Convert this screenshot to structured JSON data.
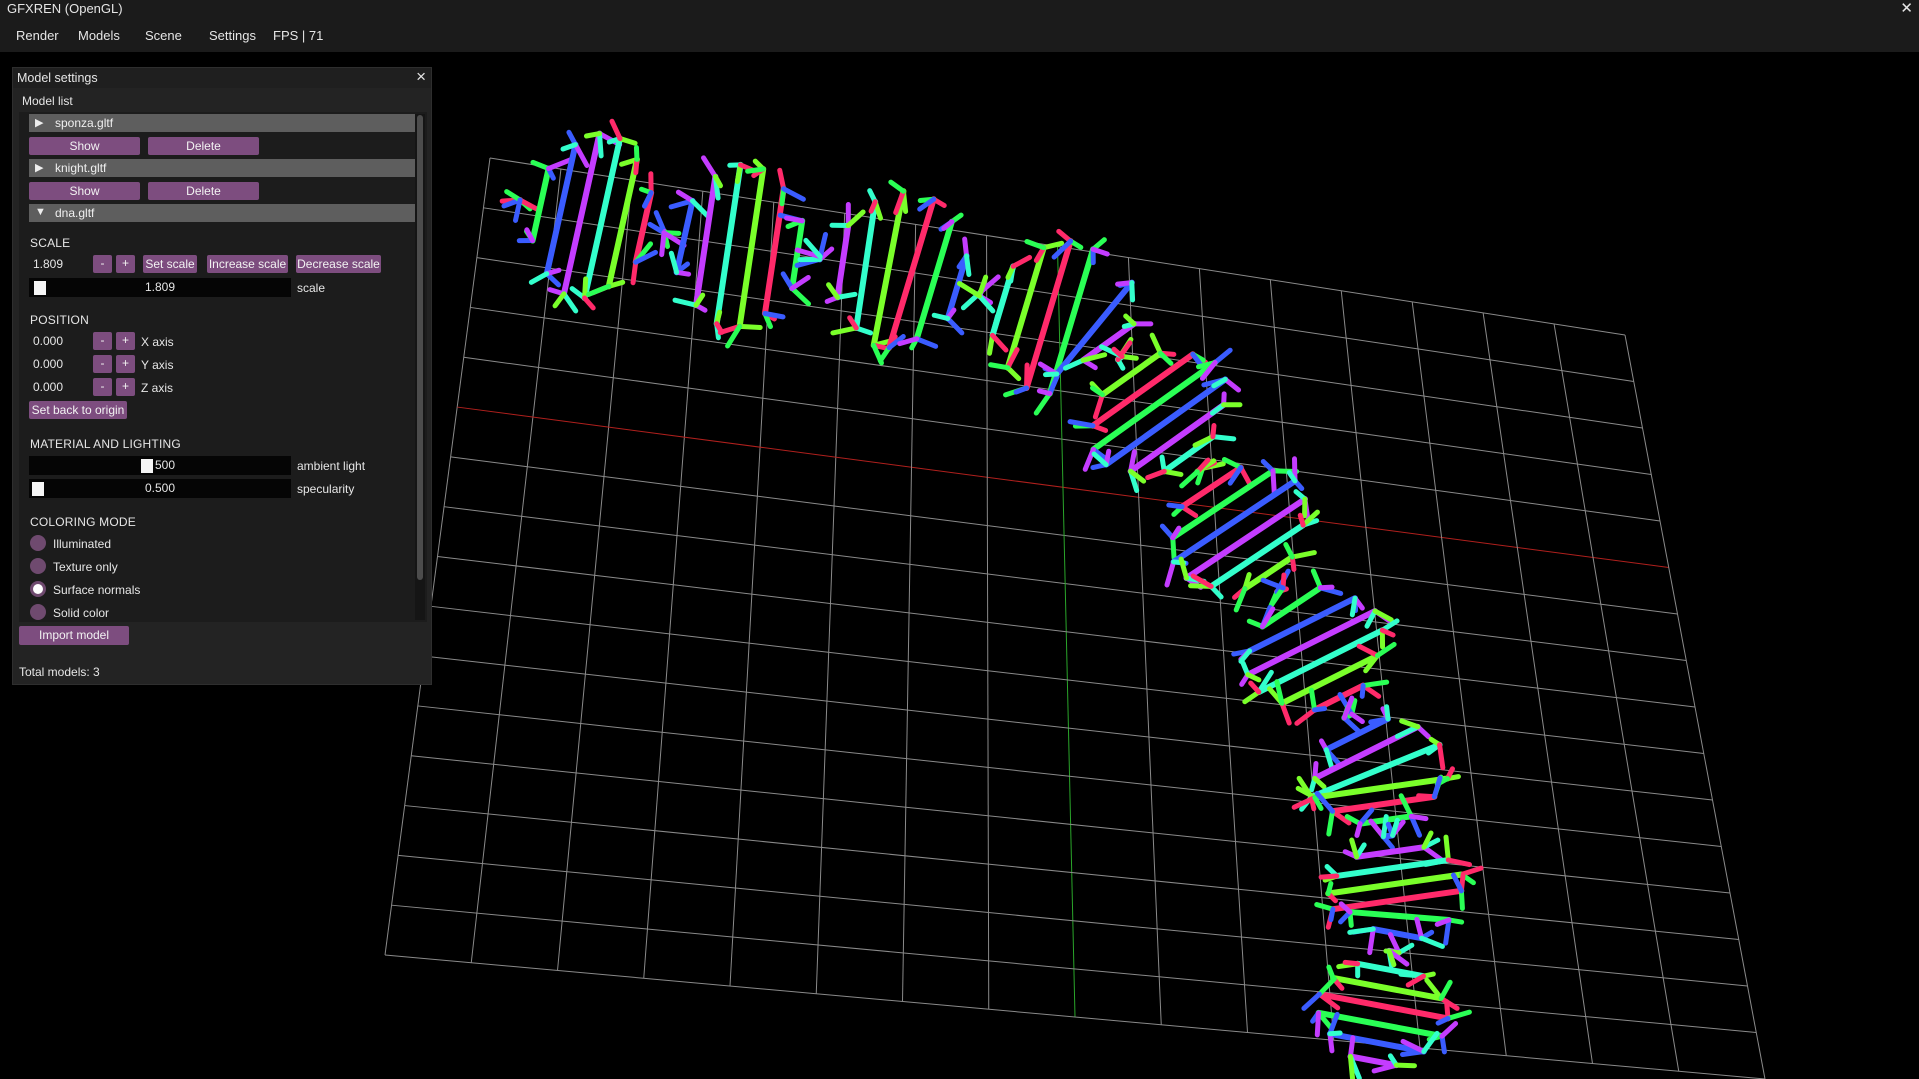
{
  "window": {
    "title": "GFXREN (OpenGL)",
    "close_icon": "close-icon"
  },
  "menu": {
    "render": "Render",
    "models": "Models",
    "scene": "Scene",
    "settings": "Settings",
    "fps": "FPS | 71"
  },
  "panel": {
    "title": "Model settings",
    "model_list_label": "Model list",
    "models": [
      {
        "name": "sponza.gltf",
        "expanded": false,
        "show_label": "Show",
        "delete_label": "Delete"
      },
      {
        "name": "knight.gltf",
        "expanded": false,
        "show_label": "Show",
        "delete_label": "Delete"
      },
      {
        "name": "dna.gltf",
        "expanded": true
      }
    ],
    "tree_collapsed_glyph": "▶",
    "tree_expanded_glyph": "▼",
    "scale": {
      "section": "SCALE",
      "value": "1.809",
      "minus": "-",
      "plus": "+",
      "set_label": "Set scale",
      "increase_label": "Increase scale",
      "decrease_label": "Decrease scale",
      "slider_value": "1.809",
      "slider_label": "scale"
    },
    "position": {
      "section": "POSITION",
      "x_value": "0.000",
      "x_label": "X axis",
      "y_value": "0.000",
      "y_label": "Y axis",
      "z_value": "0.000",
      "z_label": "Z axis",
      "minus": "-",
      "plus": "+",
      "reset_label": "Set back to origin"
    },
    "material": {
      "section": "MATERIAL AND LIGHTING",
      "ambient_value": "0.500",
      "ambient_display": "500",
      "ambient_label": "ambient light",
      "specularity_value": "0.500",
      "specularity_label": "specularity"
    },
    "coloring": {
      "section": "COLORING MODE",
      "options": [
        "Illuminated",
        "Texture only",
        "Surface normals",
        "Solid color"
      ],
      "selected": "Surface normals"
    },
    "import_label": "Import model",
    "total_label": "Total models: 3"
  },
  "colors": {
    "button": "#7d4d7f",
    "header_row": "#5e5e5e",
    "panel_bg": "#232323",
    "grid": "#8a8a8a",
    "axis_x": "#b0201d",
    "axis_z": "#2aa52a"
  }
}
